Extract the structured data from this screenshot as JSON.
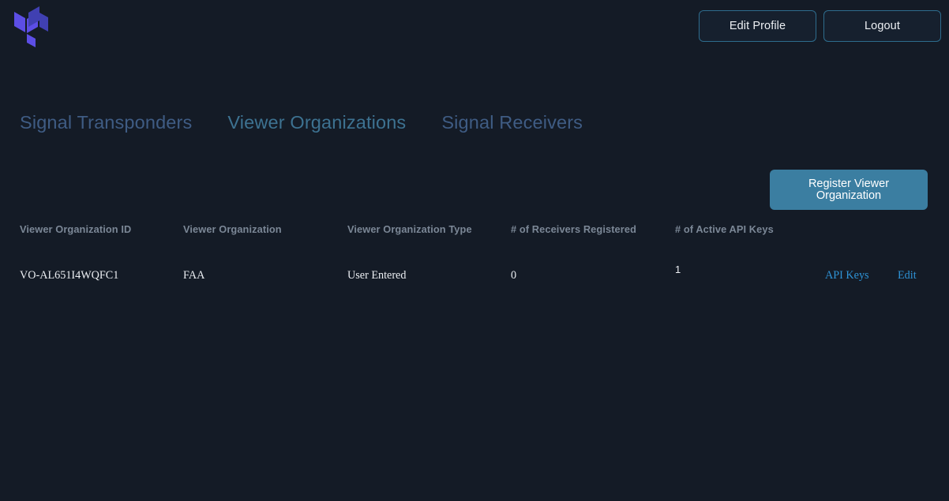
{
  "app": {
    "logo_name": "terraform-logo",
    "background_color": "#141b26",
    "accent_color": "#3b7ea1",
    "link_color": "#2e93d6",
    "logo_color_light": "#5c4ee5",
    "logo_color_dark": "#4040b2"
  },
  "header": {
    "edit_profile_label": "Edit Profile",
    "logout_label": "Logout"
  },
  "tabs": [
    {
      "label": "Signal Transponders",
      "active": false
    },
    {
      "label": "Viewer Organizations",
      "active": true
    },
    {
      "label": "Signal Receivers",
      "active": false
    }
  ],
  "actions": {
    "register_label": "Register Viewer Organization"
  },
  "table": {
    "columns": [
      "Viewer Organization ID",
      "Viewer Organization",
      "Viewer Organization Type",
      "# of Receivers Registered",
      "# of Active API Keys"
    ],
    "rows": [
      {
        "id": "VO-AL651I4WQFC1",
        "organization": "FAA",
        "type": "User Entered",
        "receivers_registered": "0",
        "active_api_keys": "1",
        "api_keys_label": "API Keys",
        "edit_label": "Edit"
      }
    ]
  }
}
